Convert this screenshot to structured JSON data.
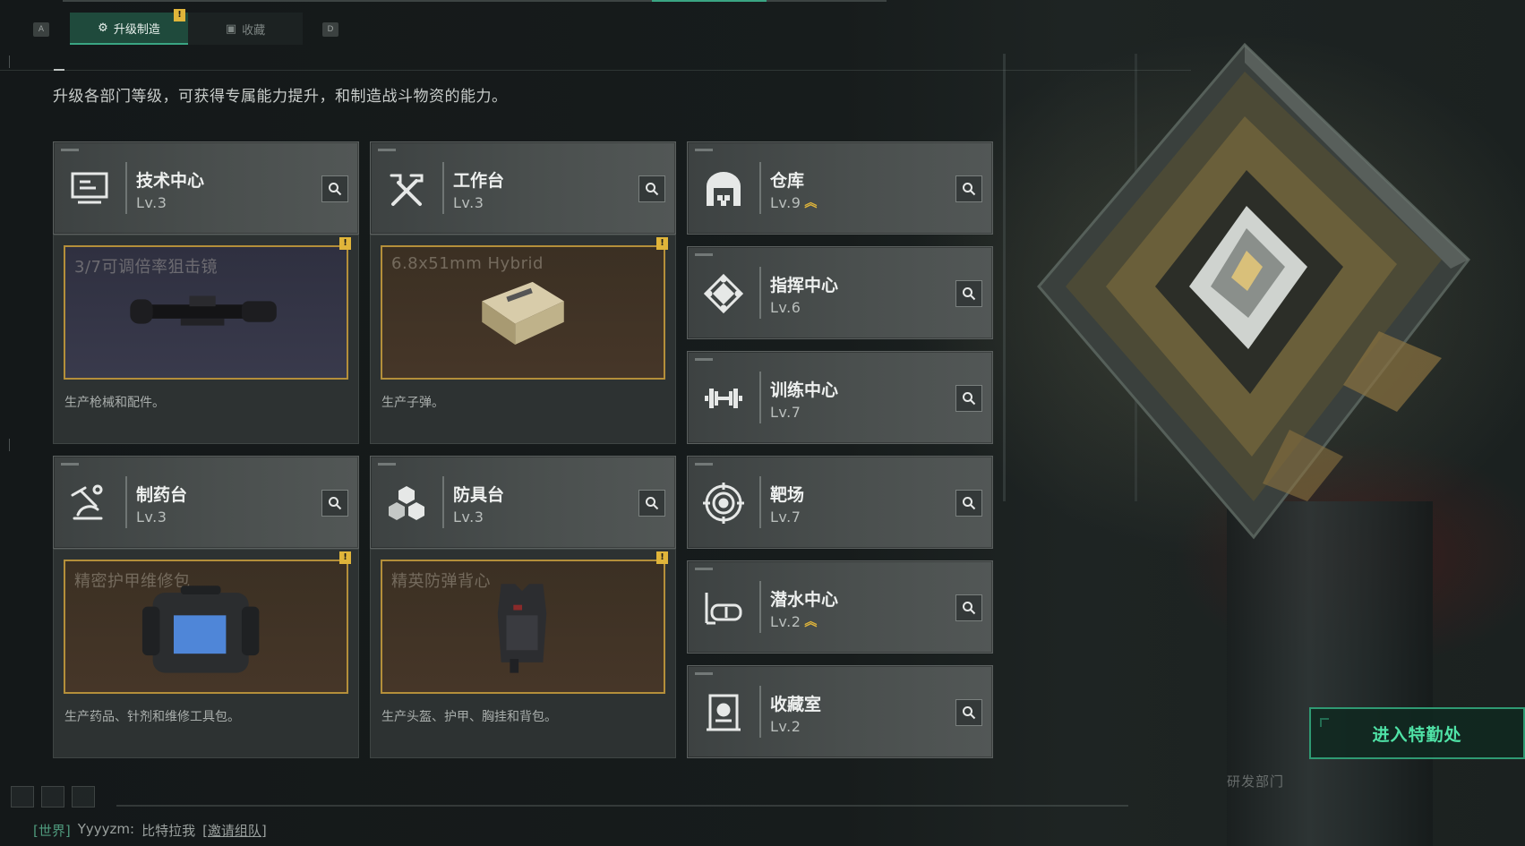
{
  "tabs": {
    "left_key": "A",
    "right_key": "D",
    "active_label": "升级制造",
    "idle_label": "收藏",
    "alert_mark": "!"
  },
  "subtitle": "升级各部门等级，可获得专属能力提升，和制造战斗物资的能力。",
  "facilities": {
    "tech": {
      "name": "技术中心",
      "level": "Lv.3"
    },
    "workbench": {
      "name": "工作台",
      "level": "Lv.3"
    },
    "warehouse": {
      "name": "仓库",
      "level": "Lv.9"
    },
    "command": {
      "name": "指挥中心",
      "level": "Lv.6"
    },
    "training": {
      "name": "训练中心",
      "level": "Lv.7"
    },
    "pharmacy": {
      "name": "制药台",
      "level": "Lv.3"
    },
    "armor": {
      "name": "防具台",
      "level": "Lv.3"
    },
    "range": {
      "name": "靶场",
      "level": "Lv.7"
    },
    "diving": {
      "name": "潜水中心",
      "level": "Lv.2"
    },
    "collection": {
      "name": "收藏室",
      "level": "Lv.2"
    }
  },
  "production": {
    "tech": {
      "item": "3/7可调倍率狙击镜",
      "desc": "生产枪械和配件。",
      "flag": "!"
    },
    "workbench": {
      "item": "6.8x51mm Hybrid",
      "desc": "生产子弹。",
      "flag": "!"
    },
    "pharmacy": {
      "item": "精密护甲维修包",
      "desc": "生产药品、针剂和维修工具包。",
      "flag": "!"
    },
    "armor": {
      "item": "精英防弹背心",
      "desc": "生产头盔、护甲、胸挂和背包。",
      "flag": "!"
    }
  },
  "enter_button": "进入特勤处",
  "dept_mark": "研发部门",
  "chat": {
    "channel": "[世界]",
    "user": "Yyyyzm:",
    "message": "比特拉我",
    "invite": "[邀请组队]"
  },
  "colors": {
    "accent_green": "#3aa583",
    "alert_yellow": "#e0b53a",
    "frame_gold": "#b48f3a",
    "button_text": "#4fe2a6"
  },
  "icons": [
    "monitor-icon",
    "tools-icon",
    "warehouse-icon",
    "command-icon",
    "dumbbell-icon",
    "microscope-icon",
    "cubes-icon",
    "target-icon",
    "diving-mask-icon",
    "trophy-case-icon",
    "search-icon",
    "level-up-icon"
  ]
}
